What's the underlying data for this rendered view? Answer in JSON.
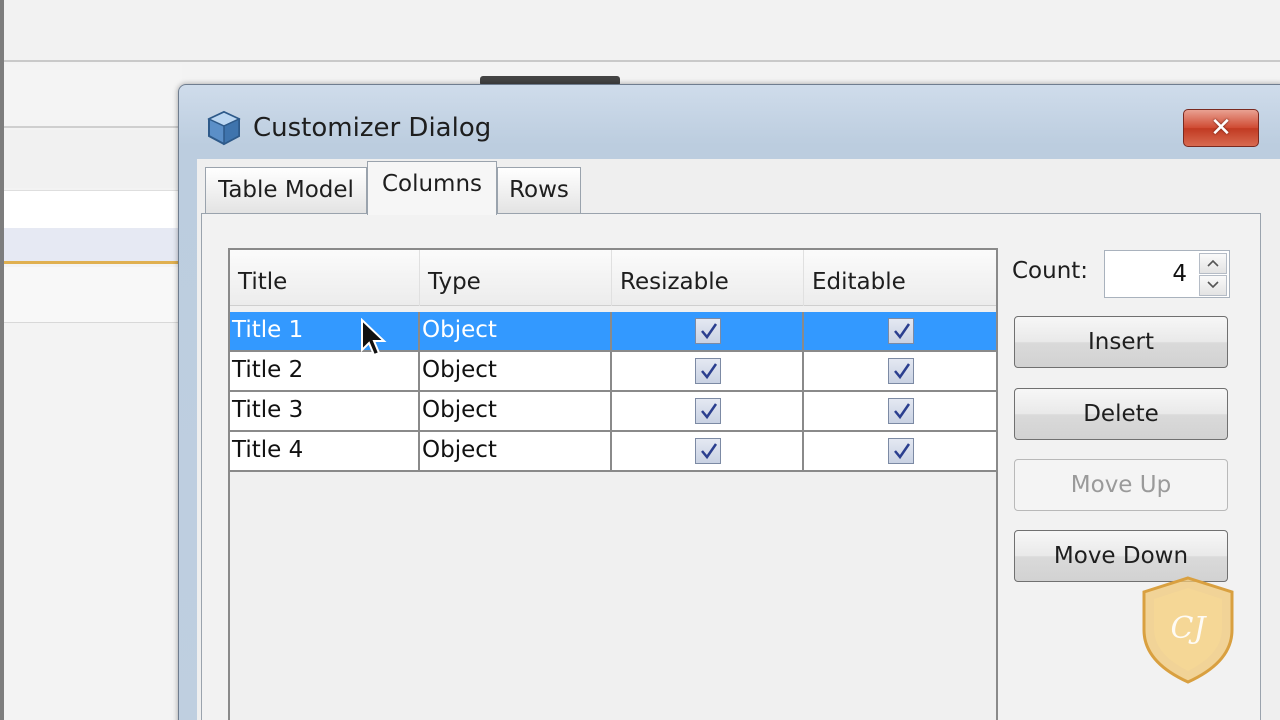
{
  "dialog": {
    "title": "Customizer Dialog",
    "close_icon": "close-x-icon"
  },
  "tabs": [
    {
      "label": "Table Model",
      "active": false
    },
    {
      "label": "Columns",
      "active": true
    },
    {
      "label": "Rows",
      "active": false
    }
  ],
  "table": {
    "headers": [
      "Title",
      "Type",
      "Resizable",
      "Editable"
    ],
    "rows": [
      {
        "title": "Title 1",
        "type": "Object",
        "resizable": true,
        "editable": true,
        "selected": true
      },
      {
        "title": "Title 2",
        "type": "Object",
        "resizable": true,
        "editable": true,
        "selected": false
      },
      {
        "title": "Title 3",
        "type": "Object",
        "resizable": true,
        "editable": true,
        "selected": false
      },
      {
        "title": "Title 4",
        "type": "Object",
        "resizable": true,
        "editable": true,
        "selected": false
      }
    ]
  },
  "count": {
    "label": "Count:",
    "value": "4"
  },
  "buttons": {
    "insert": "Insert",
    "delete": "Delete",
    "move_up": "Move Up",
    "move_down": "Move Down"
  },
  "watermark": {
    "monogram": "CJ"
  },
  "colors": {
    "selection": "#3399ff",
    "close_button": "#c9452c"
  }
}
